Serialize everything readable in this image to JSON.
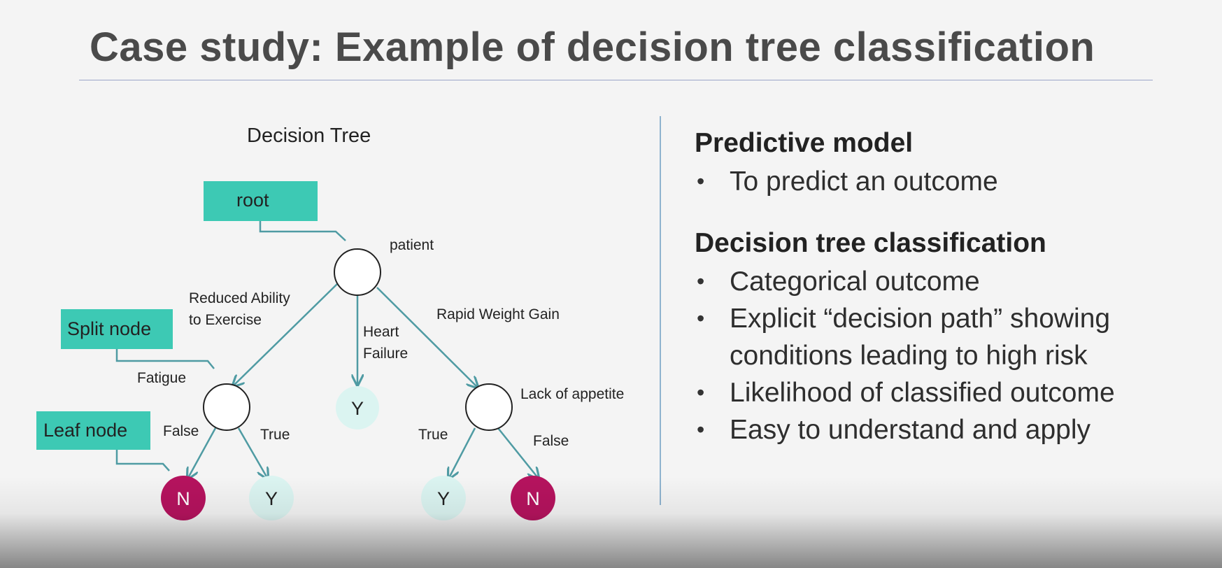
{
  "slide": {
    "title": "Case study: Example of decision tree classification"
  },
  "diagram": {
    "heading": "Decision Tree",
    "callouts": {
      "root": "root",
      "split": "Split node",
      "leaf": "Leaf node"
    },
    "nodes": {
      "patient": "patient",
      "fatigue": "Fatigue",
      "lack_of_appetite": "Lack of appetite"
    },
    "edges": {
      "reduced_line1": "Reduced Ability",
      "reduced_line2": "to Exercise",
      "heart_line1": "Heart",
      "heart_line2": "Failure",
      "rapid": "Rapid Weight Gain",
      "fatigue_false": "False",
      "fatigue_true": "True",
      "appetite_true": "True",
      "appetite_false": "False"
    },
    "leaves": {
      "heart": "Y",
      "fatigue_false": "N",
      "fatigue_true": "Y",
      "appetite_true": "Y",
      "appetite_false": "N"
    },
    "colors": {
      "callout_fill": "#3dc9b4",
      "arrow": "#4f9ba3",
      "yes_leaf": "#dbf4f1",
      "no_leaf": "#b5135e",
      "node_stroke": "#222222"
    }
  },
  "panel": {
    "sections": [
      {
        "heading": "Predictive model",
        "bullets": [
          "To predict an outcome"
        ]
      },
      {
        "heading": "Decision tree classification",
        "bullets": [
          "Categorical outcome",
          "Explicit “decision path” showing conditions leading to high risk",
          "Likelihood of classified outcome",
          "Easy to understand and apply"
        ]
      }
    ]
  }
}
